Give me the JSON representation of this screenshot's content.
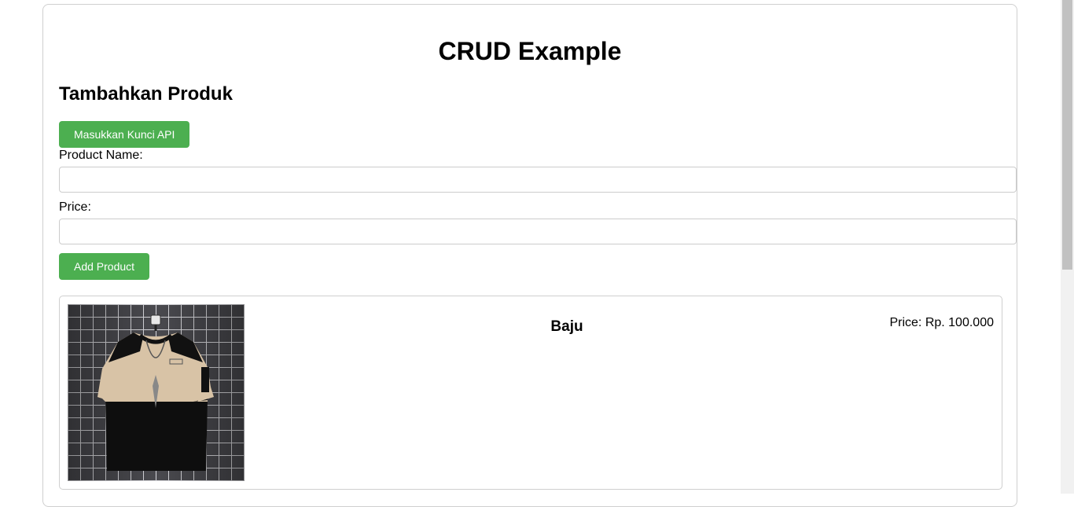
{
  "page": {
    "title": "CRUD Example"
  },
  "form": {
    "section_title": "Tambahkan Produk",
    "api_key_button": "Masukkan Kunci API",
    "product_name_label": "Product Name:",
    "product_name_value": "",
    "price_label": "Price:",
    "price_value": "",
    "add_button": "Add Product"
  },
  "products": [
    {
      "name": "Baju",
      "price": "Price: Rp. 100.000",
      "image_icon": "tshirt-photo"
    }
  ],
  "colors": {
    "button_bg": "#4caf50",
    "button_text": "#ffffff",
    "border": "#cfcfcf"
  }
}
